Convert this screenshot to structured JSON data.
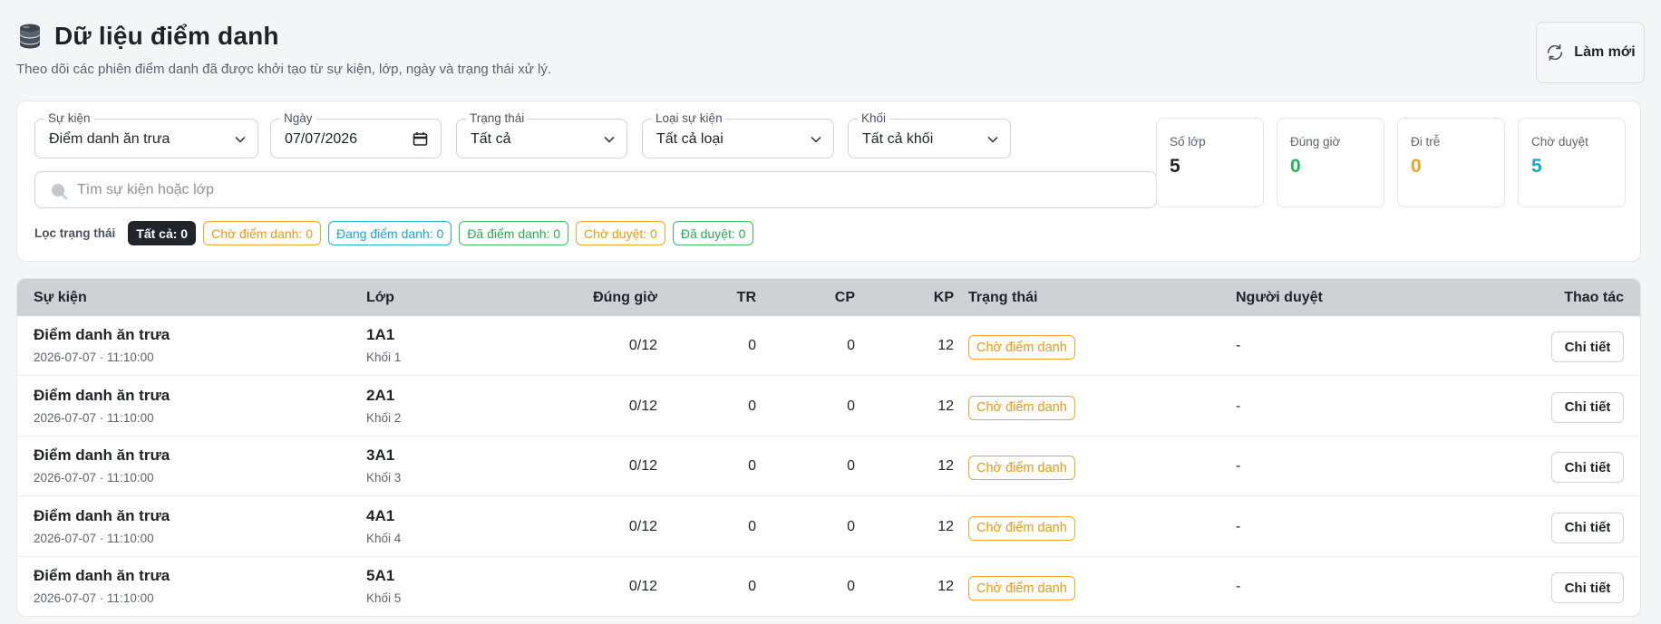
{
  "header": {
    "title": "Dữ liệu điểm danh",
    "subtitle": "Theo dõi các phiên điểm danh đã được khởi tạo từ sự kiện, lớp, ngày và trạng thái xử lý.",
    "refresh_label": "Làm mới",
    "icons": {
      "title": "database-icon",
      "refresh": "refresh-icon"
    }
  },
  "filters": {
    "event": {
      "label": "Sự kiện",
      "value": "Điểm danh ăn trưa"
    },
    "date": {
      "label": "Ngày",
      "value": "07/07/2026"
    },
    "status": {
      "label": "Trạng thái",
      "value": "Tất cả"
    },
    "event_type": {
      "label": "Loại sự kiện",
      "value": "Tất cả loại"
    },
    "grade": {
      "label": "Khối",
      "value": "Tất cả khối"
    },
    "search": {
      "placeholder": "Tìm sự kiện hoặc lớp",
      "value": ""
    },
    "status_filter_label": "Lọc trạng thái",
    "chips": {
      "all": "Tất cả: 0",
      "waiting": "Chờ điểm danh: 0",
      "in_progress": "Đang điểm danh: 0",
      "done": "Đã điểm danh: 0",
      "pending": "Chờ duyệt: 0",
      "approved": "Đã duyệt: 0"
    }
  },
  "stats": {
    "classes": {
      "label": "Số lớp",
      "value": "5",
      "color": "#1f2328"
    },
    "on_time": {
      "label": "Đúng giờ",
      "value": "0",
      "color": "#27b35a"
    },
    "late": {
      "label": "Đi trễ",
      "value": "0",
      "color": "#f0a214"
    },
    "pending": {
      "label": "Chờ duyệt",
      "value": "5",
      "color": "#1aa6c7"
    }
  },
  "table": {
    "columns": {
      "event": "Sự kiện",
      "class": "Lớp",
      "on_time": "Đúng giờ",
      "tr": "TR",
      "cp": "CP",
      "kp": "KP",
      "status": "Trạng thái",
      "approver": "Người duyệt",
      "actions": "Thao tác"
    },
    "rows": [
      {
        "event": "Điểm danh ăn trưa",
        "time": "2026-07-07 · 11:10:00",
        "class": "1A1",
        "grade": "Khối 1",
        "on_time": "0/12",
        "tr": "0",
        "cp": "0",
        "kp": "12",
        "status": "Chờ điểm danh",
        "approver": "-",
        "action": "Chi tiết"
      },
      {
        "event": "Điểm danh ăn trưa",
        "time": "2026-07-07 · 11:10:00",
        "class": "2A1",
        "grade": "Khối 2",
        "on_time": "0/12",
        "tr": "0",
        "cp": "0",
        "kp": "12",
        "status": "Chờ điểm danh",
        "approver": "-",
        "action": "Chi tiết"
      },
      {
        "event": "Điểm danh ăn trưa",
        "time": "2026-07-07 · 11:10:00",
        "class": "3A1",
        "grade": "Khối 3",
        "on_time": "0/12",
        "tr": "0",
        "cp": "0",
        "kp": "12",
        "status": "Chờ điểm danh",
        "approver": "-",
        "action": "Chi tiết"
      },
      {
        "event": "Điểm danh ăn trưa",
        "time": "2026-07-07 · 11:10:00",
        "class": "4A1",
        "grade": "Khối 4",
        "on_time": "0/12",
        "tr": "0",
        "cp": "0",
        "kp": "12",
        "status": "Chờ điểm danh",
        "approver": "-",
        "action": "Chi tiết"
      },
      {
        "event": "Điểm danh ăn trưa",
        "time": "2026-07-07 · 11:10:00",
        "class": "5A1",
        "grade": "Khối 5",
        "on_time": "0/12",
        "tr": "0",
        "cp": "0",
        "kp": "12",
        "status": "Chờ điểm danh",
        "approver": "-",
        "action": "Chi tiết"
      }
    ]
  }
}
